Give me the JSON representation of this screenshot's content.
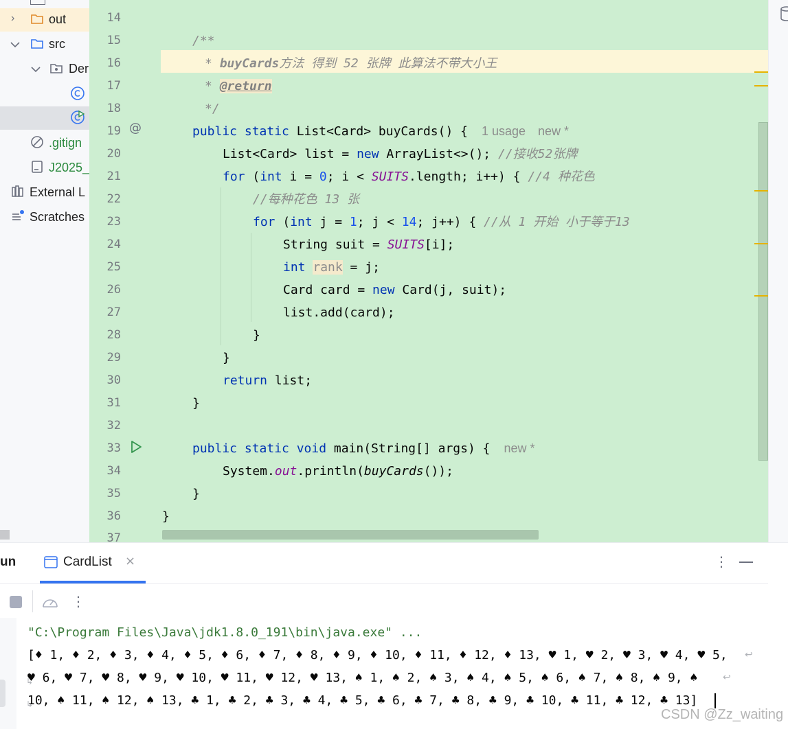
{
  "project_tree": {
    "items": [
      {
        "label": "out",
        "icon": "folder-icon",
        "expanded": false
      },
      {
        "label": "src",
        "icon": "folder-icon",
        "expanded": true
      },
      {
        "label": "Der",
        "icon": "package-icon",
        "expanded": true
      },
      {
        "label": "",
        "icon": "class-icon"
      },
      {
        "label": "",
        "icon": "runnable-class-icon"
      },
      {
        "label": ".gitign",
        "icon": "ignored-file-icon"
      },
      {
        "label": "J2025_",
        "icon": "module-file-icon"
      },
      {
        "label": "External L",
        "icon": "library-icon"
      },
      {
        "label": "Scratches",
        "icon": "scratches-icon"
      }
    ]
  },
  "editor": {
    "gutter_icons": [
      {
        "line": "19",
        "icon": "override-at-icon"
      },
      {
        "line": "33",
        "icon": "run-icon"
      }
    ],
    "lines": [
      {
        "n": "14"
      },
      {
        "n": "15",
        "doc": "/**"
      },
      {
        "n": "16",
        "doc_prefix": "* ",
        "doc_bold": "buyCards",
        "doc_rest": "方法 得到 52 张牌 此算法不带大小王"
      },
      {
        "n": "17",
        "doc_prefix": "* ",
        "doc_tag": "@return"
      },
      {
        "n": "18",
        "doc": "*/"
      },
      {
        "n": "19",
        "kw1": "public static ",
        "text": "List<Card> buyCards() {",
        "hint1": "1 usage",
        "hint2": "new *"
      },
      {
        "n": "20",
        "text1": "List<Card> list = ",
        "kw": "new",
        "text2": " ArrayList<>(); ",
        "comment": "//接收52张牌"
      },
      {
        "n": "21",
        "kw1": "for",
        "text1": " (",
        "kw2": "int",
        "text2": " i = ",
        "num1": "0",
        "text3": "; i < ",
        "stat": "SUITS",
        "text4": ".length; i++) { ",
        "comment": "//4 种花色"
      },
      {
        "n": "22",
        "comment": "//每种花色 13 张"
      },
      {
        "n": "23",
        "kw1": "for",
        "text1": " (",
        "kw2": "int",
        "text2": " j = ",
        "num1": "1",
        "text3": "; j < ",
        "num2": "14",
        "text4": "; j++) { ",
        "comment": "//从 1 开始 小于等于13"
      },
      {
        "n": "24",
        "text1": "String suit = ",
        "stat": "SUITS",
        "text2": "[i];"
      },
      {
        "n": "25",
        "kw": "int",
        "text1": " ",
        "var": "rank",
        "text2": " = j;"
      },
      {
        "n": "26",
        "text1": "Card card = ",
        "kw": "new",
        "text2": " Card(j, suit);"
      },
      {
        "n": "27",
        "text": "list.add(card);"
      },
      {
        "n": "28",
        "text": "}"
      },
      {
        "n": "29",
        "text": "}"
      },
      {
        "n": "30",
        "kw": "return",
        "text": " list;"
      },
      {
        "n": "31",
        "text": "}"
      },
      {
        "n": "32"
      },
      {
        "n": "33",
        "kw1": "public static void ",
        "text": "main(String[] args) {",
        "hint": "new *"
      },
      {
        "n": "34",
        "text1": "System.",
        "stat": "out",
        "text2": ".println(",
        "itf": "buyCards",
        "text3": "());"
      },
      {
        "n": "35",
        "text": "}"
      },
      {
        "n": "36",
        "text": "}"
      },
      {
        "n": "37"
      }
    ]
  },
  "run_panel": {
    "title": "un",
    "tab_label": "CardList",
    "console": {
      "command": "\"C:\\Program Files\\Java\\jdk1.8.0_191\\bin\\java.exe\" ...",
      "out1": "[♦ 1, ♦ 2, ♦ 3, ♦ 4, ♦ 5, ♦ 6, ♦ 7, ♦ 8, ♦ 9, ♦ 10, ♦ 11, ♦ 12, ♦ 13, ♥ 1, ♥ 2, ♥ 3, ♥ 4, ♥ 5,",
      "out2": "♥ 6, ♥ 7, ♥ 8, ♥ 9, ♥ 10, ♥ 11, ♥ 12, ♥ 13, ♠ 1, ♠ 2, ♠ 3, ♠ 4, ♠ 5, ♠ 6, ♠ 7, ♠ 8, ♠ 9, ♠",
      "out3": "10, ♠ 11, ♠ 12, ♠ 13, ♣ 1, ♣ 2, ♣ 3, ♣ 4, ♣ 5, ♣ 6, ♣ 7, ♣ 8, ♣ 9, ♣ 10, ♣ 11, ♣ 12, ♣ 13]"
    }
  },
  "watermark": "CSDN @Zz_waiting",
  "colors": {
    "editor_bg": "#cdeed1",
    "current_line": "#fdf6d8",
    "keyword": "#0033b3",
    "number": "#1750eb",
    "comment": "#8c8c8c",
    "static_field": "#871094",
    "tab_underline": "#3574f0"
  }
}
